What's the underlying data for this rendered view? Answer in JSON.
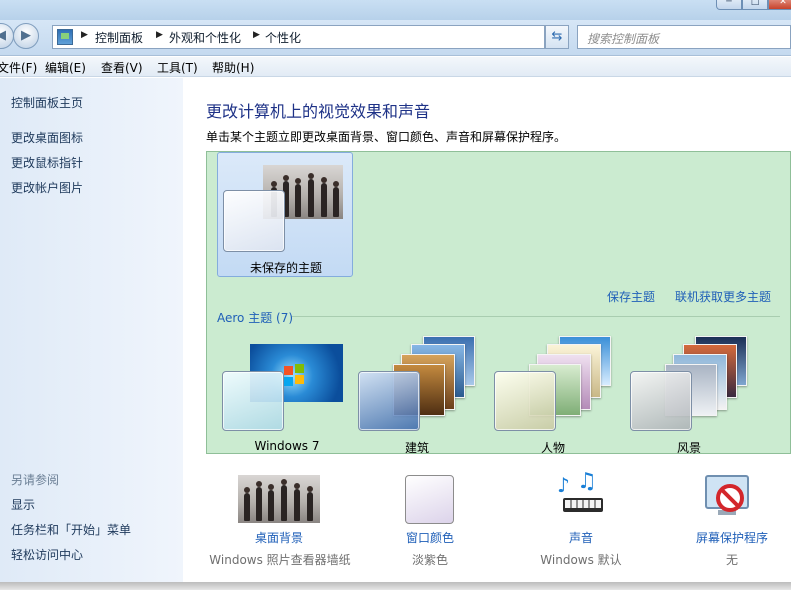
{
  "address_bar": {
    "breadcrumbs": [
      "控制面板",
      "外观和个性化",
      "个性化"
    ],
    "search_placeholder": "搜索控制面板"
  },
  "menubar": {
    "items": [
      "文件(F)",
      "编辑(E)",
      "查看(V)",
      "工具(T)",
      "帮助(H)"
    ]
  },
  "left_pane": {
    "home_link": "控制面板主页",
    "links": [
      "更改桌面图标",
      "更改鼠标指针",
      "更改帐户图片"
    ],
    "see_also_heading": "另请参阅",
    "see_also_links": [
      "显示",
      "任务栏和「开始」菜单",
      "轻松访问中心"
    ]
  },
  "main": {
    "title": "更改计算机上的视觉效果和声音",
    "description": "单击某个主题立即更改桌面背景、窗口颜色、声音和屏幕保护程序。",
    "my_themes": {
      "unsaved_theme_label": "未保存的主题",
      "save_theme_link": "保存主题",
      "get_more_link": "联机获取更多主题"
    },
    "aero": {
      "heading": "Aero 主题 (7)",
      "themes": [
        "Windows 7",
        "建筑",
        "人物",
        "风景"
      ]
    }
  },
  "bottom_settings": {
    "desktop_background": {
      "label": "桌面背景",
      "value": "Windows 照片查看器墙纸"
    },
    "window_color": {
      "label": "窗口颜色",
      "value": "淡紫色"
    },
    "sounds": {
      "label": "声音",
      "value": "Windows 默认"
    },
    "screen_saver": {
      "label": "屏幕保护程序",
      "value": "无"
    }
  },
  "colors": {
    "theme_panel_bg": "#cbebd0",
    "link_blue": "#1f5fb8",
    "title_blue": "#1e3287",
    "left_pane_bg": "#dfeaf7"
  }
}
